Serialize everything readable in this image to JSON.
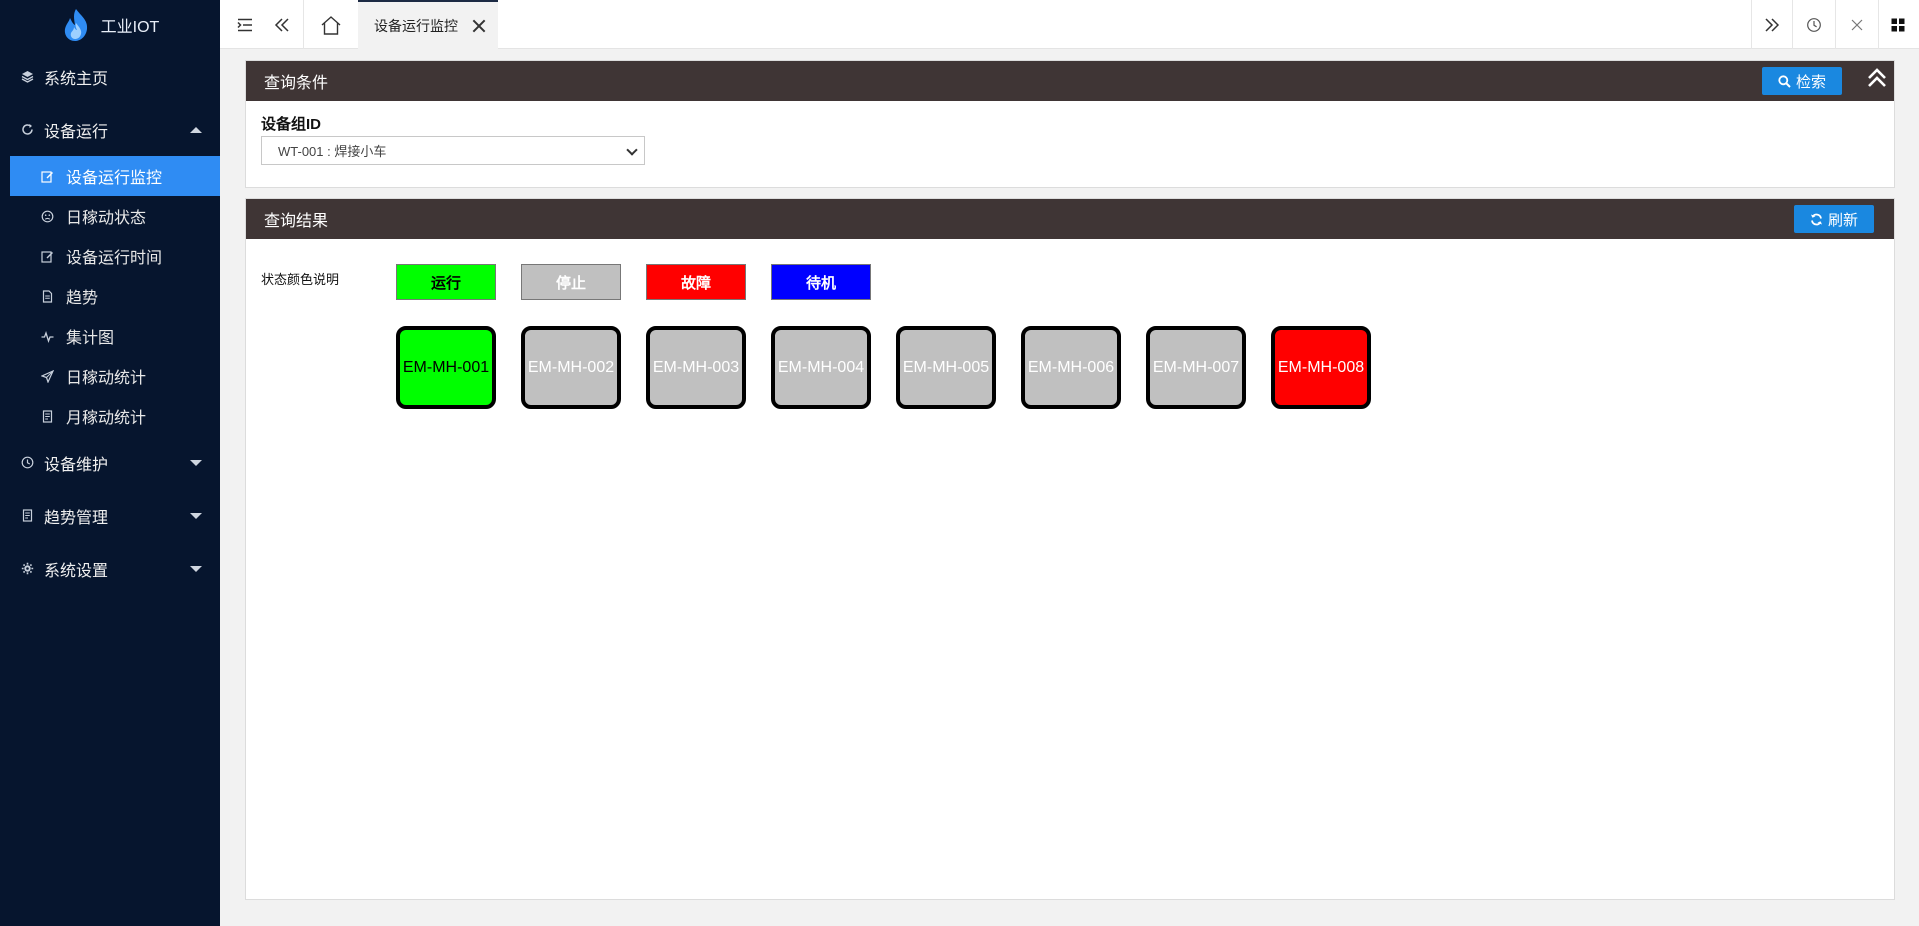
{
  "app": {
    "logo_text": "工业IOT"
  },
  "colors": {
    "sidebar_bg": "#06152e",
    "active_blue": "#2f8cf3",
    "panel_header": "#3f3535",
    "button_blue": "#1a88e0",
    "run": "#00ff00",
    "stop": "#c0c0c0",
    "fault": "#ff0000",
    "standby": "#0000ff"
  },
  "sidebar": {
    "home": {
      "label": "系统主页",
      "icon": "layers-icon"
    },
    "equipment_run": {
      "label": "设备运行",
      "icon": "refresh-icon",
      "items": [
        {
          "label": "设备运行监控",
          "icon": "edit-icon",
          "active": true
        },
        {
          "label": "日稼动状态",
          "icon": "face-icon"
        },
        {
          "label": "设备运行时间",
          "icon": "edit-icon"
        },
        {
          "label": "趋势",
          "icon": "file-icon"
        },
        {
          "label": "集计图",
          "icon": "pulse-icon"
        },
        {
          "label": "日稼动统计",
          "icon": "send-icon"
        },
        {
          "label": "月稼动统计",
          "icon": "doc-icon"
        }
      ]
    },
    "maintenance": {
      "label": "设备维护",
      "icon": "clock-icon"
    },
    "trend_mgmt": {
      "label": "趋势管理",
      "icon": "doc-icon"
    },
    "settings": {
      "label": "系统设置",
      "icon": "gear-icon"
    }
  },
  "topbar": {
    "tab_label": "设备运行监控"
  },
  "query": {
    "title": "查询条件",
    "search_label": "检索",
    "field_label": "设备组ID",
    "selected_value": "WT-001 : 焊接小车"
  },
  "result": {
    "title": "查询结果",
    "refresh_label": "刷新",
    "legend_title": "状态颜色说明",
    "legend": [
      {
        "label": "运行",
        "color": "#00ff00",
        "text_color": "#000000"
      },
      {
        "label": "停止",
        "color": "#c0c0c0",
        "text_color": "#ffffff"
      },
      {
        "label": "故障",
        "color": "#ff0000",
        "text_color": "#ffffff"
      },
      {
        "label": "待机",
        "color": "#0000ff",
        "text_color": "#ffffff"
      }
    ],
    "devices": [
      {
        "id": "EM-MH-001",
        "status": "运行",
        "color": "#00ff00",
        "text_color": "#000000"
      },
      {
        "id": "EM-MH-002",
        "status": "停止",
        "color": "#c0c0c0",
        "text_color": "#ffffff"
      },
      {
        "id": "EM-MH-003",
        "status": "停止",
        "color": "#c0c0c0",
        "text_color": "#ffffff"
      },
      {
        "id": "EM-MH-004",
        "status": "停止",
        "color": "#c0c0c0",
        "text_color": "#ffffff"
      },
      {
        "id": "EM-MH-005",
        "status": "停止",
        "color": "#c0c0c0",
        "text_color": "#ffffff"
      },
      {
        "id": "EM-MH-006",
        "status": "停止",
        "color": "#c0c0c0",
        "text_color": "#ffffff"
      },
      {
        "id": "EM-MH-007",
        "status": "停止",
        "color": "#c0c0c0",
        "text_color": "#ffffff"
      },
      {
        "id": "EM-MH-008",
        "status": "故障",
        "color": "#ff0000",
        "text_color": "#ffffff"
      }
    ]
  }
}
